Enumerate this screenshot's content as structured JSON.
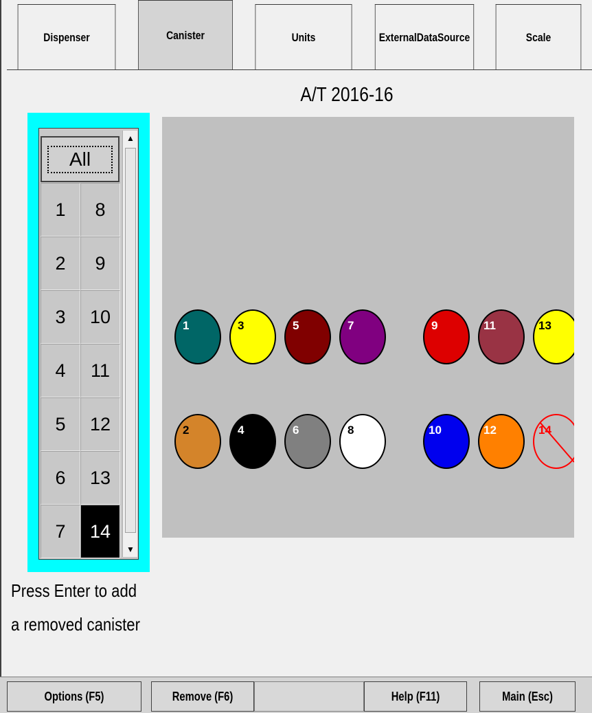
{
  "tabs": [
    {
      "label": "Dispenser"
    },
    {
      "label": "Canister",
      "active": true
    },
    {
      "label": "Units"
    },
    {
      "label": "ExternalDataSource"
    },
    {
      "label": "Scale"
    }
  ],
  "title": "A/T 2016-16",
  "list": {
    "all_label": "All",
    "rows": [
      [
        "1",
        "8"
      ],
      [
        "2",
        "9"
      ],
      [
        "3",
        "10"
      ],
      [
        "4",
        "11"
      ],
      [
        "5",
        "12"
      ],
      [
        "6",
        "13"
      ],
      [
        "7",
        "14"
      ]
    ],
    "selected": "14"
  },
  "hint_line1": "Press Enter to add",
  "hint_line2": "a removed canister",
  "canisters": [
    {
      "label": "1",
      "color": "#006666",
      "text": "#ffffff"
    },
    {
      "label": "3",
      "color": "#ffff00",
      "text": "#000000"
    },
    {
      "label": "5",
      "color": "#800000",
      "text": "#ffffff"
    },
    {
      "label": "7",
      "color": "#800080",
      "text": "#ffffff"
    },
    {
      "label": "9",
      "color": "#dd0000",
      "text": "#ffffff"
    },
    {
      "label": "11",
      "color": "#993344",
      "text": "#ffffff"
    },
    {
      "label": "13",
      "color": "#ffff00",
      "text": "#000000"
    },
    {
      "label": "2",
      "color": "#d4842a",
      "text": "#000000"
    },
    {
      "label": "4",
      "color": "#000000",
      "text": "#ffffff"
    },
    {
      "label": "6",
      "color": "#808080",
      "text": "#ffffff"
    },
    {
      "label": "8",
      "color": "#ffffff",
      "text": "#000000"
    },
    {
      "label": "10",
      "color": "#0000ee",
      "text": "#ffffff"
    },
    {
      "label": "12",
      "color": "#ff8000",
      "text": "#ffffff"
    },
    {
      "label": "14",
      "color": "#c0c0c0",
      "text": "#ff0000",
      "removed": true
    }
  ],
  "buttons": {
    "options": "Options (F5)",
    "remove": "Remove (F6)",
    "help": "Help (F11)",
    "main": "Main (Esc)"
  }
}
